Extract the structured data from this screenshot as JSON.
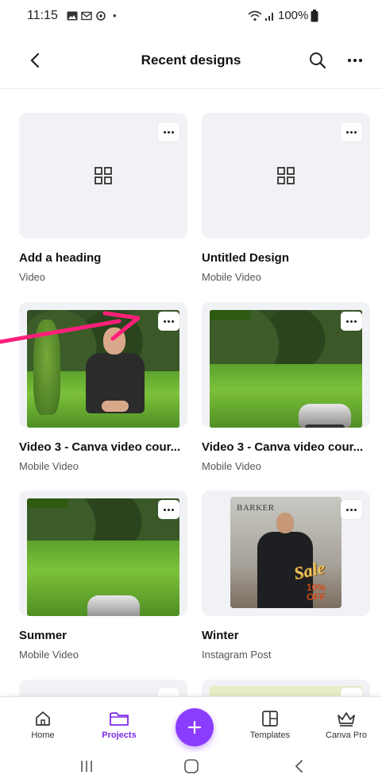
{
  "status_bar": {
    "time": "11:15",
    "dot": "•",
    "battery": "100%"
  },
  "header": {
    "title": "Recent designs"
  },
  "designs": [
    {
      "title": "Add a heading",
      "type": "Video"
    },
    {
      "title": "Untitled Design",
      "type": "Mobile Video"
    },
    {
      "title": "Video 3 - Canva video cour...",
      "type": "Mobile Video"
    },
    {
      "title": "Video 3 - Canva video cour...",
      "type": "Mobile Video"
    },
    {
      "title": "Summer",
      "type": "Mobile Video"
    },
    {
      "title": "Winter",
      "type": "Instagram Post"
    }
  ],
  "poster": {
    "brand": "BARKER",
    "sale": "Sale",
    "discount_line1": "10%",
    "discount_line2": "OFF"
  },
  "bottom_nav": {
    "home": "Home",
    "projects": "Projects",
    "templates": "Templates",
    "canva_pro": "Canva Pro",
    "active": "projects"
  },
  "colors": {
    "accent": "#8b3dff",
    "active_label": "#7d2ae8",
    "arrow": "#ff1f7a"
  }
}
